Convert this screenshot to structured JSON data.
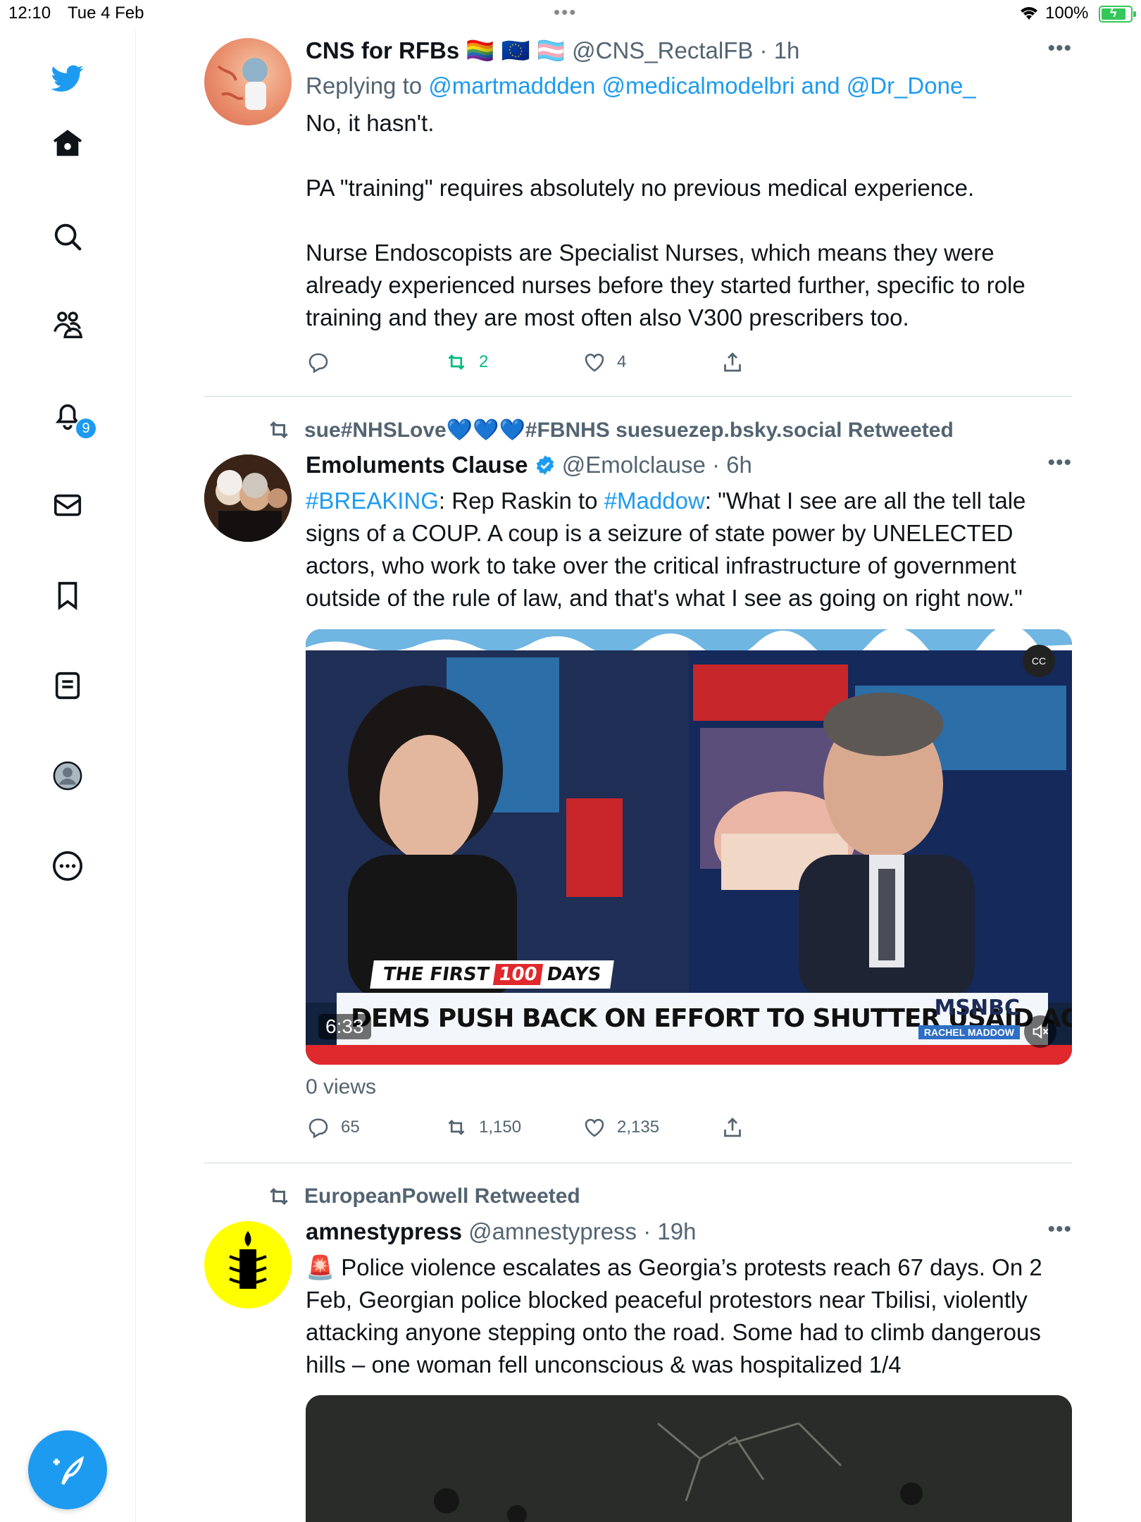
{
  "status_bar": {
    "time": "12:10",
    "date": "Tue 4 Feb",
    "battery": "100%"
  },
  "sidebar": {
    "items": [
      {
        "name": "home"
      },
      {
        "name": "explore"
      },
      {
        "name": "communities"
      },
      {
        "name": "notifications",
        "badge": "9"
      },
      {
        "name": "messages"
      },
      {
        "name": "bookmarks"
      },
      {
        "name": "lists"
      },
      {
        "name": "profile"
      },
      {
        "name": "more"
      }
    ],
    "accent": "#1d9bf0"
  },
  "tweets": [
    {
      "name": "CNS for RFBs",
      "flags": "🏳️‍🌈 🇪🇺 🏳️‍⚧️",
      "handle": "@CNS_RectalFB",
      "time": "· 1h",
      "replying_prefix": "Replying to",
      "replying_mentions": "@martmaddden @medicalmodelbri",
      "replying_and": "and",
      "replying_last": "@Dr_Done_",
      "text": "No, it hasn't.\n\nPA \"training\" requires absolutely no previous medical experience.\n\nNurse Endoscopists are Specialist Nurses, which means they were already experienced nurses before they started further, specific to role training and they are most often also V300 prescribers too.",
      "replies": "",
      "retweets": "2",
      "likes": "4"
    },
    {
      "retweeted_by": "sue#NHSLove💙💙💙#FBNHS suesuezep.bsky.social Retweeted",
      "name": "Emoluments Clause",
      "handle": "@Emolclause",
      "time": "· 6h",
      "text_parts": [
        "#BREAKING",
        ": Rep Raskin to ",
        "#Maddow",
        ": \"What I see are all the tell tale signs of a COUP. A coup is a seizure of state power by UNELECTED actors, who work to take over the critical infrastructure of government outside of the rule of law, and that's what I see as going on right now.\""
      ],
      "video": {
        "kicker_a": "THE FIRST",
        "kicker_num": "100",
        "kicker_b": "DAYS",
        "headline": "DEMS PUSH BACK ON EFFORT TO SHUTTER USAID AGENCY",
        "brand": "MSNBC",
        "show": "RACHEL MADDOW",
        "duration": "6:33"
      },
      "views": "0 views",
      "replies": "65",
      "retweets": "1,150",
      "likes": "2,135"
    },
    {
      "retweeted_by": "EuropeanPowell Retweeted",
      "name": "amnestypress",
      "handle": "@amnestypress",
      "time": "· 19h",
      "text": "🚨 Police violence escalates as Georgia’s protests reach 67 days. On 2 Feb, Georgian police blocked peaceful protestors near Tbilisi, violently attacking anyone stepping onto the road. Some had to climb dangerous hills – one woman fell unconscious & was hospitalized 1/4"
    }
  ]
}
